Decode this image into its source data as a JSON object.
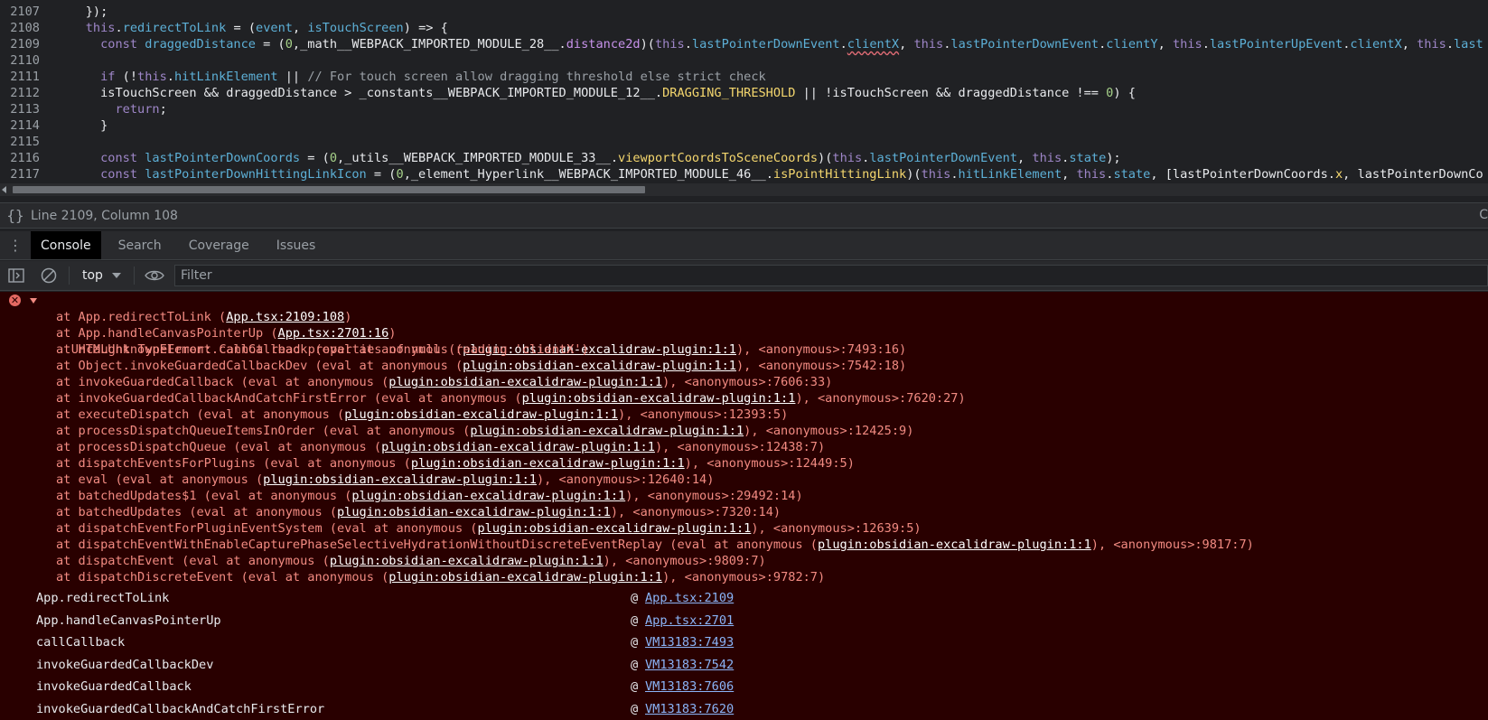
{
  "editor": {
    "lines": [
      {
        "num": "2107",
        "segments": [
          {
            "t": "    });",
            "c": ""
          }
        ]
      },
      {
        "num": "2108",
        "segments": [
          {
            "t": "    ",
            "c": ""
          },
          {
            "t": "this",
            "c": "kw"
          },
          {
            "t": ".",
            "c": ""
          },
          {
            "t": "redirectToLink",
            "c": "prop"
          },
          {
            "t": " = (",
            "c": ""
          },
          {
            "t": "event",
            "c": "prop"
          },
          {
            "t": ", ",
            "c": ""
          },
          {
            "t": "isTouchScreen",
            "c": "prop"
          },
          {
            "t": ") => {",
            "c": ""
          }
        ]
      },
      {
        "num": "2109",
        "segments": [
          {
            "t": "      ",
            "c": ""
          },
          {
            "t": "const",
            "c": "kw"
          },
          {
            "t": " ",
            "c": ""
          },
          {
            "t": "draggedDistance",
            "c": "prop"
          },
          {
            "t": " = (",
            "c": ""
          },
          {
            "t": "0",
            "c": "num"
          },
          {
            "t": ",_math__WEBPACK_IMPORTED_MODULE_28__.",
            "c": ""
          },
          {
            "t": "distance2d",
            "c": "fn"
          },
          {
            "t": ")(",
            "c": ""
          },
          {
            "t": "this",
            "c": "kw"
          },
          {
            "t": ".",
            "c": ""
          },
          {
            "t": "lastPointerDownEvent",
            "c": "prop"
          },
          {
            "t": ".",
            "c": ""
          },
          {
            "t": "clientX",
            "c": "prop squig"
          },
          {
            "t": ", ",
            "c": ""
          },
          {
            "t": "this",
            "c": "kw"
          },
          {
            "t": ".",
            "c": ""
          },
          {
            "t": "lastPointerDownEvent",
            "c": "prop"
          },
          {
            "t": ".",
            "c": ""
          },
          {
            "t": "clientY",
            "c": "prop"
          },
          {
            "t": ", ",
            "c": ""
          },
          {
            "t": "this",
            "c": "kw"
          },
          {
            "t": ".",
            "c": ""
          },
          {
            "t": "lastPointerUpEvent",
            "c": "prop"
          },
          {
            "t": ".",
            "c": ""
          },
          {
            "t": "clientX",
            "c": "prop"
          },
          {
            "t": ", ",
            "c": ""
          },
          {
            "t": "this",
            "c": "kw"
          },
          {
            "t": ".",
            "c": ""
          },
          {
            "t": "last",
            "c": "prop"
          }
        ]
      },
      {
        "num": "2110",
        "segments": [
          {
            "t": "",
            "c": ""
          }
        ]
      },
      {
        "num": "2111",
        "segments": [
          {
            "t": "      ",
            "c": ""
          },
          {
            "t": "if",
            "c": "kw"
          },
          {
            "t": " (!",
            "c": ""
          },
          {
            "t": "this",
            "c": "kw"
          },
          {
            "t": ".",
            "c": ""
          },
          {
            "t": "hitLinkElement",
            "c": "prop"
          },
          {
            "t": " || ",
            "c": ""
          },
          {
            "t": "// For touch screen allow dragging threshold else strict check",
            "c": "cmt"
          }
        ]
      },
      {
        "num": "2112",
        "segments": [
          {
            "t": "      isTouchScreen && draggedDistance > _constants__WEBPACK_IMPORTED_MODULE_12__.",
            "c": ""
          },
          {
            "t": "DRAGGING_THRESHOLD",
            "c": "cst"
          },
          {
            "t": " || !isTouchScreen && draggedDistance !== ",
            "c": ""
          },
          {
            "t": "0",
            "c": "num"
          },
          {
            "t": ") {",
            "c": ""
          }
        ]
      },
      {
        "num": "2113",
        "segments": [
          {
            "t": "        ",
            "c": ""
          },
          {
            "t": "return",
            "c": "kw"
          },
          {
            "t": ";",
            "c": ""
          }
        ]
      },
      {
        "num": "2114",
        "segments": [
          {
            "t": "      }",
            "c": ""
          }
        ]
      },
      {
        "num": "2115",
        "segments": [
          {
            "t": "",
            "c": ""
          }
        ]
      },
      {
        "num": "2116",
        "segments": [
          {
            "t": "      ",
            "c": ""
          },
          {
            "t": "const",
            "c": "kw"
          },
          {
            "t": " ",
            "c": ""
          },
          {
            "t": "lastPointerDownCoords",
            "c": "prop"
          },
          {
            "t": " = (",
            "c": ""
          },
          {
            "t": "0",
            "c": "num"
          },
          {
            "t": ",_utils__WEBPACK_IMPORTED_MODULE_33__.",
            "c": ""
          },
          {
            "t": "viewportCoordsToSceneCoords",
            "c": "func"
          },
          {
            "t": ")(",
            "c": ""
          },
          {
            "t": "this",
            "c": "kw"
          },
          {
            "t": ".",
            "c": ""
          },
          {
            "t": "lastPointerDownEvent",
            "c": "prop"
          },
          {
            "t": ", ",
            "c": ""
          },
          {
            "t": "this",
            "c": "kw"
          },
          {
            "t": ".",
            "c": ""
          },
          {
            "t": "state",
            "c": "prop"
          },
          {
            "t": ");",
            "c": ""
          }
        ]
      },
      {
        "num": "2117",
        "segments": [
          {
            "t": "      ",
            "c": ""
          },
          {
            "t": "const",
            "c": "kw"
          },
          {
            "t": " ",
            "c": ""
          },
          {
            "t": "lastPointerDownHittingLinkIcon",
            "c": "prop"
          },
          {
            "t": " = (",
            "c": ""
          },
          {
            "t": "0",
            "c": "num"
          },
          {
            "t": ",_element_Hyperlink__WEBPACK_IMPORTED_MODULE_46__.",
            "c": ""
          },
          {
            "t": "isPointHittingLink",
            "c": "func"
          },
          {
            "t": ")(",
            "c": ""
          },
          {
            "t": "this",
            "c": "kw"
          },
          {
            "t": ".",
            "c": ""
          },
          {
            "t": "hitLinkElement",
            "c": "prop"
          },
          {
            "t": ", ",
            "c": ""
          },
          {
            "t": "this",
            "c": "kw"
          },
          {
            "t": ".",
            "c": ""
          },
          {
            "t": "state",
            "c": "prop"
          },
          {
            "t": ", [lastPointerDownCoords.",
            "c": ""
          },
          {
            "t": "x",
            "c": "cst"
          },
          {
            "t": ", lastPointerDownCo",
            "c": ""
          }
        ]
      }
    ]
  },
  "status": {
    "position": "Line 2109, Column 108",
    "right": "C"
  },
  "drawer": {
    "tabs": [
      "Console",
      "Search",
      "Coverage",
      "Issues"
    ],
    "active": "Console"
  },
  "toolbar": {
    "context": "top",
    "filter_placeholder": "Filter"
  },
  "console": {
    "error_message": "Uncaught TypeError: Cannot read properties of null (reading 'clientX')",
    "frames": [
      {
        "pre": "at App.redirectToLink (",
        "link": "App.tsx:2109:108",
        "post": ")"
      },
      {
        "pre": "at App.handleCanvasPointerUp (",
        "link": "App.tsx:2701:16",
        "post": ")"
      },
      {
        "pre": "at HTMLUnknownElement.callCallback (eval at anonymous (",
        "link": "plugin:obsidian-excalidraw-plugin:1:1",
        "post": "), <anonymous>:7493:16)"
      },
      {
        "pre": "at Object.invokeGuardedCallbackDev (eval at anonymous (",
        "link": "plugin:obsidian-excalidraw-plugin:1:1",
        "post": "), <anonymous>:7542:18)"
      },
      {
        "pre": "at invokeGuardedCallback (eval at anonymous (",
        "link": "plugin:obsidian-excalidraw-plugin:1:1",
        "post": "), <anonymous>:7606:33)"
      },
      {
        "pre": "at invokeGuardedCallbackAndCatchFirstError (eval at anonymous (",
        "link": "plugin:obsidian-excalidraw-plugin:1:1",
        "post": "), <anonymous>:7620:27)"
      },
      {
        "pre": "at executeDispatch (eval at anonymous (",
        "link": "plugin:obsidian-excalidraw-plugin:1:1",
        "post": "), <anonymous>:12393:5)"
      },
      {
        "pre": "at processDispatchQueueItemsInOrder (eval at anonymous (",
        "link": "plugin:obsidian-excalidraw-plugin:1:1",
        "post": "), <anonymous>:12425:9)"
      },
      {
        "pre": "at processDispatchQueue (eval at anonymous (",
        "link": "plugin:obsidian-excalidraw-plugin:1:1",
        "post": "), <anonymous>:12438:7)"
      },
      {
        "pre": "at dispatchEventsForPlugins (eval at anonymous (",
        "link": "plugin:obsidian-excalidraw-plugin:1:1",
        "post": "), <anonymous>:12449:5)"
      },
      {
        "pre": "at eval (eval at anonymous (",
        "link": "plugin:obsidian-excalidraw-plugin:1:1",
        "post": "), <anonymous>:12640:14)"
      },
      {
        "pre": "at batchedUpdates$1 (eval at anonymous (",
        "link": "plugin:obsidian-excalidraw-plugin:1:1",
        "post": "), <anonymous>:29492:14)"
      },
      {
        "pre": "at batchedUpdates (eval at anonymous (",
        "link": "plugin:obsidian-excalidraw-plugin:1:1",
        "post": "), <anonymous>:7320:14)"
      },
      {
        "pre": "at dispatchEventForPluginEventSystem (eval at anonymous (",
        "link": "plugin:obsidian-excalidraw-plugin:1:1",
        "post": "), <anonymous>:12639:5)"
      },
      {
        "pre": "at dispatchEventWithEnableCapturePhaseSelectiveHydrationWithoutDiscreteEventReplay (eval at anonymous (",
        "link": "plugin:obsidian-excalidraw-plugin:1:1",
        "post": "), <anonymous>:9817:7)"
      },
      {
        "pre": "at dispatchEvent (eval at anonymous (",
        "link": "plugin:obsidian-excalidraw-plugin:1:1",
        "post": "), <anonymous>:9809:7)"
      },
      {
        "pre": "at dispatchDiscreteEvent (eval at anonymous (",
        "link": "plugin:obsidian-excalidraw-plugin:1:1",
        "post": "), <anonymous>:9782:7)"
      }
    ],
    "stack_table": [
      {
        "fn": "App.redirectToLink",
        "at": "@",
        "src": "App.tsx:2109"
      },
      {
        "fn": "App.handleCanvasPointerUp",
        "at": "@",
        "src": "App.tsx:2701"
      },
      {
        "fn": "callCallback",
        "at": "@",
        "src": "VM13183:7493"
      },
      {
        "fn": "invokeGuardedCallbackDev",
        "at": "@",
        "src": "VM13183:7542"
      },
      {
        "fn": "invokeGuardedCallback",
        "at": "@",
        "src": "VM13183:7606"
      },
      {
        "fn": "invokeGuardedCallbackAndCatchFirstError",
        "at": "@",
        "src": "VM13183:7620"
      }
    ]
  },
  "icons": {
    "pretty_print": "braces-icon",
    "menu": "kebab-icon",
    "sidebar_toggle": "sidebar-toggle-icon",
    "clear": "clear-console-icon",
    "live_expression": "eye-icon",
    "error": "error-circle-icon"
  },
  "colors": {
    "error_bg": "#290000",
    "error_text": "#f28b82",
    "link": "#8ab4f8",
    "panel_bg": "#202124"
  }
}
